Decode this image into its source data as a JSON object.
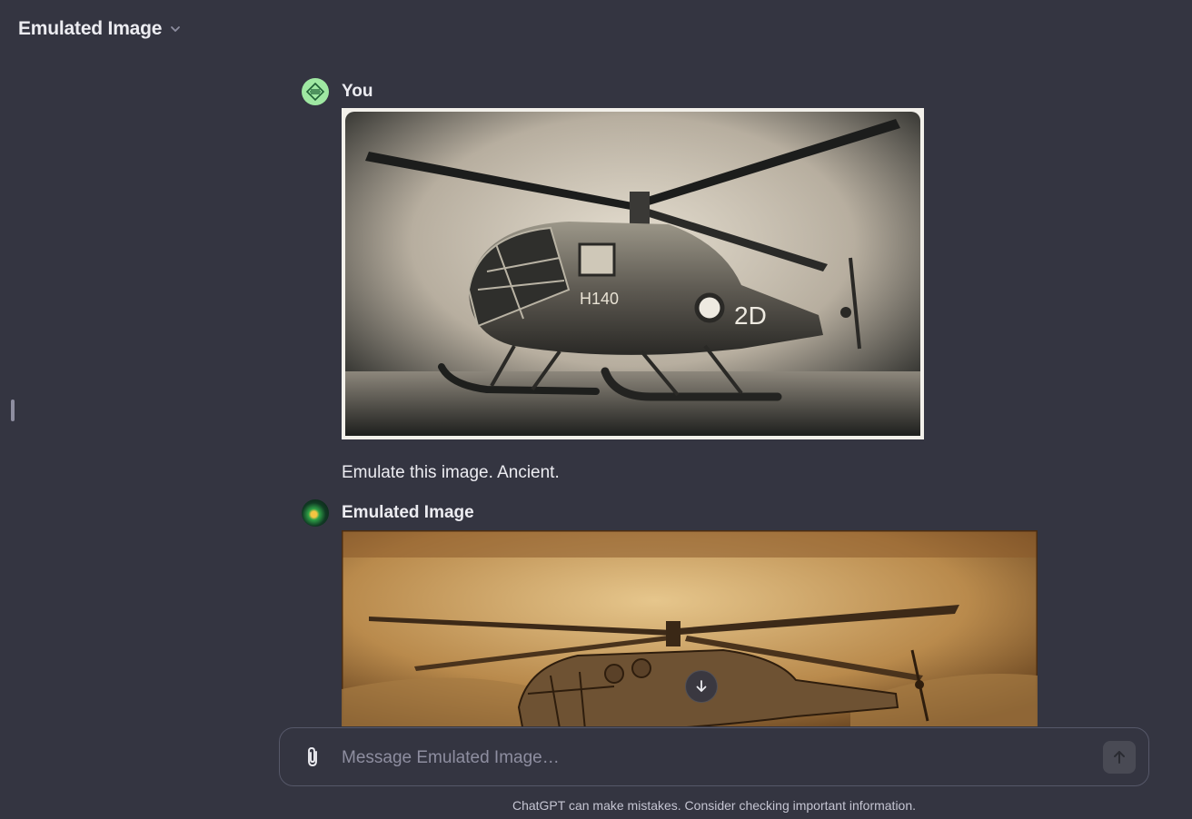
{
  "header": {
    "title": "Emulated Image",
    "dropdown_icon": "chevron-down-icon"
  },
  "messages": [
    {
      "author": "You",
      "avatar_icon": "user-avatar",
      "attachment_alt": "sepia photograph of a vintage helicopter",
      "text": "Emulate this image. Ancient."
    },
    {
      "author": "Emulated Image",
      "avatar_icon": "gpt-avatar",
      "attachment_alt": "parchment sketch of a helicopter"
    }
  ],
  "composer": {
    "placeholder": "Message Emulated Image…",
    "attach_icon": "paperclip-icon",
    "send_icon": "arrow-up-icon"
  },
  "scroll_icon": "arrow-down-icon",
  "footer": {
    "disclaimer": "ChatGPT can make mistakes. Consider checking important information."
  },
  "colors": {
    "background": "#343541",
    "text": "#ececf1",
    "muted": "#8e8ea0",
    "user_avatar": "#9fe8a2"
  }
}
